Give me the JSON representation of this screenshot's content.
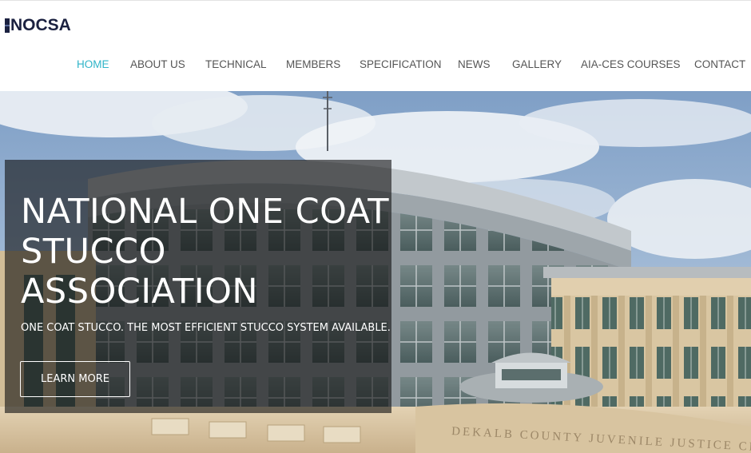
{
  "brand": {
    "logo_text": "NOCSA"
  },
  "nav": {
    "items": [
      {
        "label": "HOME",
        "active": true
      },
      {
        "label": "ABOUT US"
      },
      {
        "label": "TECHNICAL"
      },
      {
        "label": "MEMBERS"
      },
      {
        "label": "SPECIFICATION"
      },
      {
        "label": "NEWS"
      },
      {
        "label": "GALLERY"
      },
      {
        "label": "AIA-CES COURSES"
      },
      {
        "label": "CONTACT"
      }
    ]
  },
  "hero": {
    "title": "NATIONAL ONE COAT STUCCO ASSOCIATION",
    "subtitle": "ONE COAT STUCCO. THE MOST EFFICIENT STUCCO SYSTEM AVAILABLE.",
    "cta_label": "LEARN MORE",
    "building_inscription": "DEKALB COUNTY JUVENILE JUSTICE CEN"
  },
  "colors": {
    "nav_active": "#2fb4c8",
    "nav_text": "#555555",
    "logo": "#1b2140",
    "overlay": "#141414"
  }
}
